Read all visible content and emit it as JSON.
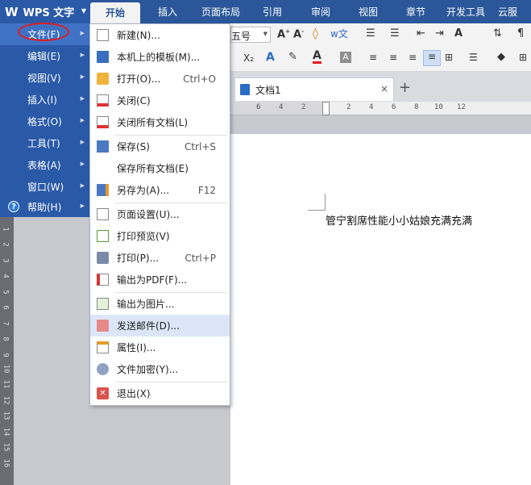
{
  "app": {
    "name": "WPS 文字",
    "logo": "W"
  },
  "tabs": [
    "开始",
    "插入",
    "页面布局",
    "引用",
    "审阅",
    "视图",
    "章节",
    "开发工具",
    "云服"
  ],
  "ribbon": {
    "font_size": "五号"
  },
  "document": {
    "tab_title": "文档1",
    "close": "×",
    "new_tab": "+",
    "body_text": "管宁割席性能小小姑娘充满充满"
  },
  "ruler_numbers": [
    "6",
    "4",
    "2",
    "2",
    "4",
    "6",
    "8",
    "10",
    "12"
  ],
  "vruler_numbers": [
    "1",
    "2",
    "3",
    "4",
    "5",
    "6",
    "7",
    "8",
    "9",
    "10",
    "11",
    "12",
    "13",
    "14",
    "15",
    "16"
  ],
  "main_menu": [
    {
      "label": "文件(F)",
      "has_sub": true
    },
    {
      "label": "编辑(E)",
      "has_sub": true
    },
    {
      "label": "视图(V)",
      "has_sub": true
    },
    {
      "label": "插入(I)",
      "has_sub": true
    },
    {
      "label": "格式(O)",
      "has_sub": true
    },
    {
      "label": "工具(T)",
      "has_sub": true
    },
    {
      "label": "表格(A)",
      "has_sub": true
    },
    {
      "label": "窗口(W)",
      "has_sub": true
    },
    {
      "label": "帮助(H)",
      "has_sub": true
    }
  ],
  "file_menu": [
    {
      "label": "新建(N)...",
      "shortcut": "",
      "icon": "new-document-icon"
    },
    {
      "label": "本机上的模板(M)...",
      "shortcut": "",
      "icon": "template-icon"
    },
    {
      "label": "打开(O)...",
      "shortcut": "Ctrl+O",
      "icon": "open-folder-icon"
    },
    {
      "label": "关闭(C)",
      "shortcut": "",
      "icon": "close-document-icon"
    },
    {
      "label": "关闭所有文档(L)",
      "shortcut": "",
      "icon": "close-all-icon"
    },
    {
      "label": "保存(S)",
      "shortcut": "Ctrl+S",
      "icon": "save-icon"
    },
    {
      "label": "保存所有文档(E)",
      "shortcut": "",
      "icon": ""
    },
    {
      "label": "另存为(A)...",
      "shortcut": "F12",
      "icon": "save-as-icon"
    },
    {
      "label": "页面设置(U)...",
      "shortcut": "",
      "icon": "page-setup-icon"
    },
    {
      "label": "打印预览(V)",
      "shortcut": "",
      "icon": "print-preview-icon"
    },
    {
      "label": "打印(P)...",
      "shortcut": "Ctrl+P",
      "icon": "print-icon"
    },
    {
      "label": "输出为PDF(F)...",
      "shortcut": "",
      "icon": "pdf-icon"
    },
    {
      "label": "输出为图片...",
      "shortcut": "",
      "icon": "image-export-icon"
    },
    {
      "label": "发送邮件(D)...",
      "shortcut": "",
      "icon": "mail-icon"
    },
    {
      "label": "属性(I)...",
      "shortcut": "",
      "icon": "properties-icon"
    },
    {
      "label": "文件加密(Y)...",
      "shortcut": "",
      "icon": "encrypt-icon"
    },
    {
      "label": "退出(X)",
      "shortcut": "",
      "icon": "exit-icon"
    }
  ]
}
